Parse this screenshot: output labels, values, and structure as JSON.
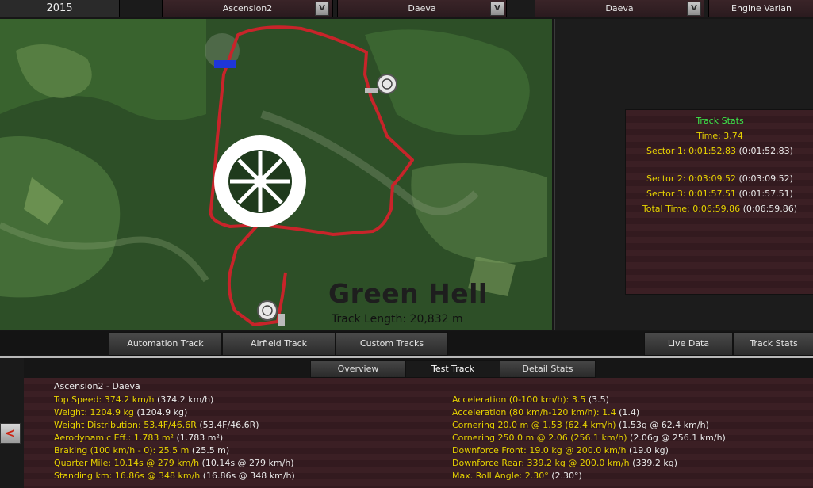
{
  "topbar": {
    "year": "2015",
    "selectors": [
      {
        "label": "Ascension2",
        "button": "V"
      },
      {
        "label": "Daeva",
        "button": "V"
      },
      {
        "label": "Daeva",
        "button": "V"
      },
      {
        "label": "Engine Varian"
      }
    ]
  },
  "map": {
    "track_name": "Green Hell",
    "track_length": "Track Length: 20,832 m"
  },
  "track_stats": {
    "title": "Track Stats",
    "time": "Time: 3.74",
    "sector1": "Sector 1: 0:01:52.83",
    "sector1_paren": "(0:01:52.83)",
    "sector2": "Sector 2: 0:03:09.52",
    "sector2_paren": "(0:03:09.52)",
    "sector3": "Sector 3: 0:01:57.51",
    "sector3_paren": "(0:01:57.51)",
    "total": "Total Time: 0:06:59.86",
    "total_paren": "(0:06:59.86)"
  },
  "track_tabs": [
    "Automation Track",
    "Airfield Track",
    "Custom Tracks"
  ],
  "right_tabs": [
    "Live Data",
    "Track Stats"
  ],
  "sub_tabs": [
    "Overview",
    "Test Track",
    "Detail Stats"
  ],
  "back_button": "<",
  "detail": {
    "title": "Ascension2 - Daeva",
    "left": [
      {
        "label": "Top Speed: 374.2 km/h",
        "paren": "(374.2 km/h)"
      },
      {
        "label": "Weight: 1204.9 kg",
        "paren": "(1204.9 kg)"
      },
      {
        "label": "Weight Distribution: 53.4F/46.6R",
        "paren": "(53.4F/46.6R)"
      },
      {
        "label": "Aerodynamic Eff.: 1.783 m²",
        "paren": "(1.783 m²)"
      },
      {
        "label": "Braking (100 km/h - 0): 25.5 m",
        "paren": "(25.5 m)"
      },
      {
        "label": "Quarter Mile: 10.14s @ 279 km/h",
        "paren": "(10.14s @ 279 km/h)"
      },
      {
        "label": "Standing km: 16.86s @ 348 km/h",
        "paren": "(16.86s @ 348 km/h)"
      }
    ],
    "right": [
      {
        "label": "Acceleration (0-100 km/h): 3.5",
        "paren": "(3.5)"
      },
      {
        "label": "Acceleration (80 km/h-120 km/h): 1.4",
        "paren": "(1.4)"
      },
      {
        "label": "Cornering 20.0 m @ 1.53 (62.4 km/h)",
        "paren": "(1.53g @ 62.4 km/h)"
      },
      {
        "label": "Cornering 250.0 m @ 2.06 (256.1 km/h)",
        "paren": "(2.06g @ 256.1 km/h)"
      },
      {
        "label": "Downforce Front: 19.0 kg @ 200.0 km/h",
        "paren": "(19.0 kg)"
      },
      {
        "label": "Downforce Rear: 339.2 kg @ 200.0 km/h",
        "paren": "(339.2 kg)"
      },
      {
        "label": "Max. Roll Angle: 2.30°",
        "paren": "(2.30°)"
      }
    ]
  },
  "colors": {
    "track_line": "#c8242a",
    "stat_value": "#e6d200",
    "stat_title": "#3ee64a",
    "panel_bg": "#3b1f24"
  }
}
